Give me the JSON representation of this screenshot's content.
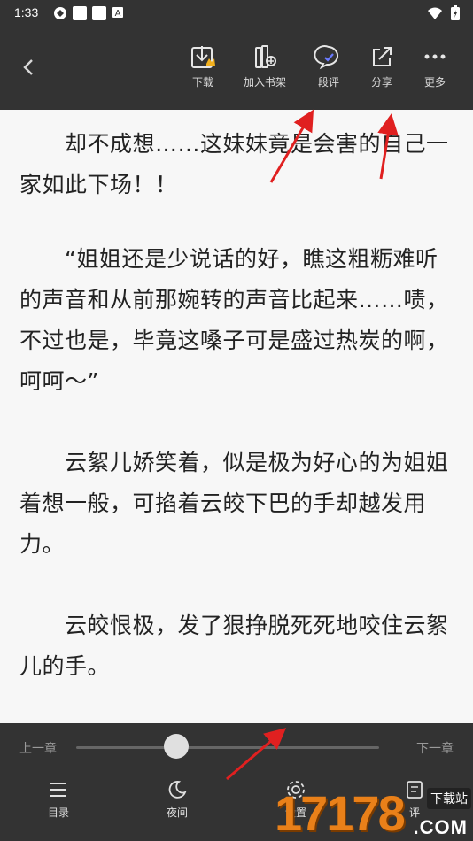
{
  "status_bar": {
    "time": "1:33",
    "icons": [
      "vpn-icon",
      "notification-square-icon",
      "notification-square-icon",
      "a-icon"
    ],
    "right_icons": [
      "wifi-icon",
      "battery-charging-icon"
    ]
  },
  "toolbar": {
    "back_icon": "chevron-left-icon",
    "download_label": "下载",
    "bookshelf_label": "加入书架",
    "comment_label": "段评",
    "share_label": "分享",
    "more_label": "更多"
  },
  "reading": {
    "paragraphs": [
      "　　却不成想……这妹妹竟是会害的自己一家如此下场！！",
      "　　“姐姐还是少说话的好，瞧这粗粝难听的声音和从前那婉转的声音比起来……啧，不过也是，毕竟这嗓子可是盛过热炭的啊，呵呵～”",
      "　　云絮儿娇笑着，似是极为好心的为姐姐着想一般，可掐着云皎下巴的手却越发用力。",
      "　　云皎恨极，发了狠挣脱死死地咬住云絮儿的手。"
    ]
  },
  "chapter_nav": {
    "prev_label": "上一章",
    "next_label": "下一章",
    "progress": 0.33
  },
  "bottom_nav": {
    "catalog_label": "目录",
    "night_label": "夜间",
    "settings_label": "设置",
    "comments_label": "评"
  },
  "watermark": {
    "number": "17178",
    "tag": "下载站",
    "domain": ".COM"
  },
  "colors": {
    "toolbar_bg": "#333333",
    "page_bg": "#f7f7f7",
    "text": "#222222",
    "arrow": "#e02020",
    "watermark": "#e98019"
  }
}
